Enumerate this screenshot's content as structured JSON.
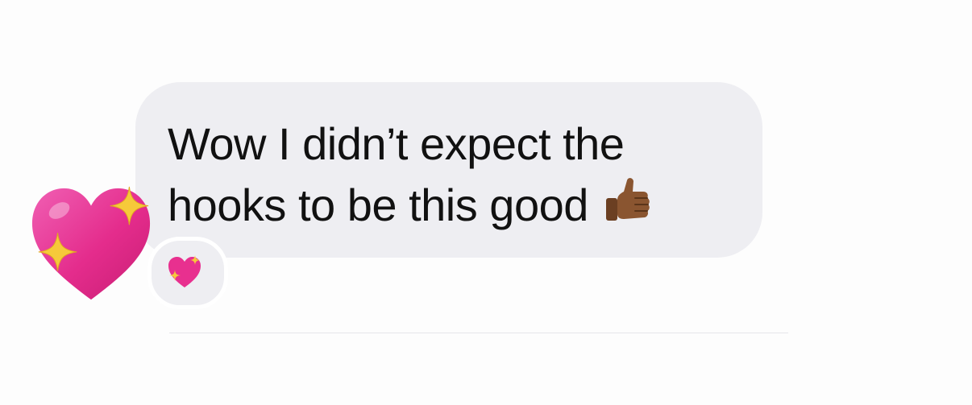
{
  "message": {
    "line1": "Wow I didn’t expect the",
    "line2": "hooks to be this good",
    "trailing_emoji": "thumbs-up-medium-dark-skin-tone-icon"
  },
  "tapback": {
    "emoji": "sparkling-heart-icon"
  },
  "colors": {
    "bubble": "#eeeef2",
    "text": "#111111",
    "heart": "#e8308f",
    "sparkle": "#f6c93a",
    "thumb": "#8a5530"
  }
}
